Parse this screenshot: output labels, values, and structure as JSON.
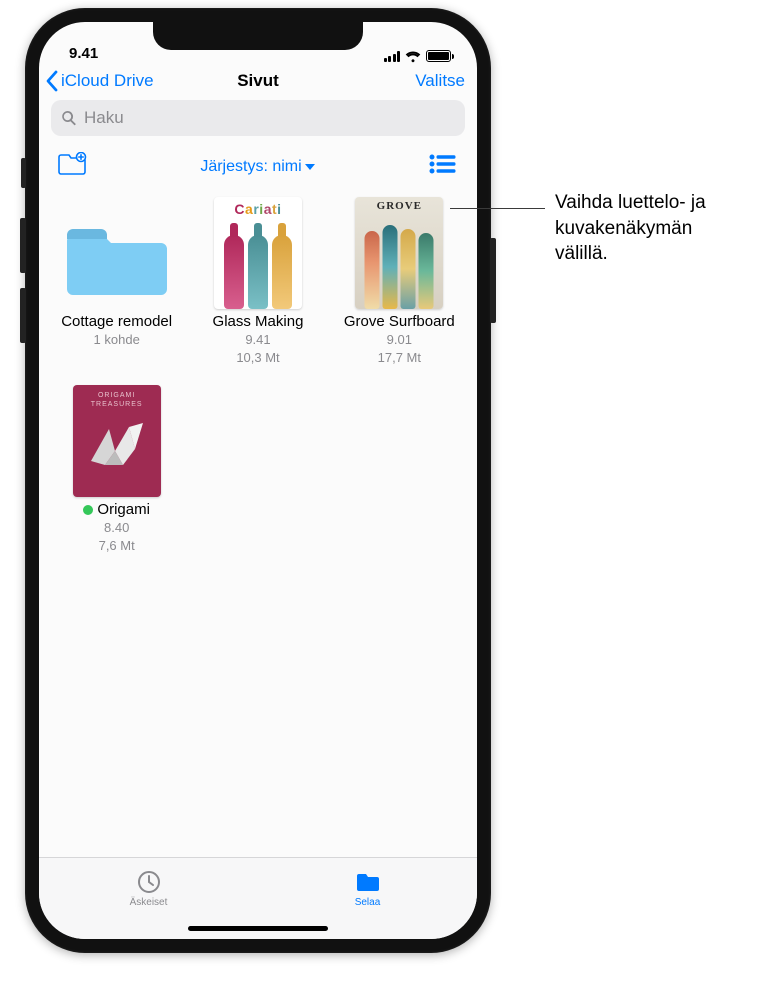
{
  "status": {
    "time": "9.41"
  },
  "nav": {
    "back_label": "iCloud Drive",
    "title": "Sivut",
    "select_label": "Valitse"
  },
  "search": {
    "placeholder": "Haku"
  },
  "toolbar": {
    "sort_label": "Järjestys: nimi"
  },
  "items": [
    {
      "type": "folder",
      "name": "Cottage remodel",
      "sub1": "1 kohde",
      "sub2": ""
    },
    {
      "type": "doc",
      "art": "cariati",
      "name": "Glass Making",
      "sub1": "9.41",
      "sub2": "10,3 Mt"
    },
    {
      "type": "doc",
      "art": "grove",
      "name": "Grove Surfboard",
      "sub1": "9.01",
      "sub2": "17,7 Mt"
    },
    {
      "type": "doc",
      "art": "origami",
      "name": "Origami",
      "sub1": "8.40",
      "sub2": "7,6 Mt",
      "status_dot": true
    }
  ],
  "tabs": {
    "recents": "Äskeiset",
    "browse": "Selaa"
  },
  "callout": {
    "line1": "Vaihda luettelo- ja",
    "line2": "kuvakenäkymän",
    "line3": "välillä."
  },
  "thumb_text": {
    "grove_title": "GROVE",
    "origami_line1": "ORIGAMI",
    "origami_line2": "TREASURES"
  }
}
